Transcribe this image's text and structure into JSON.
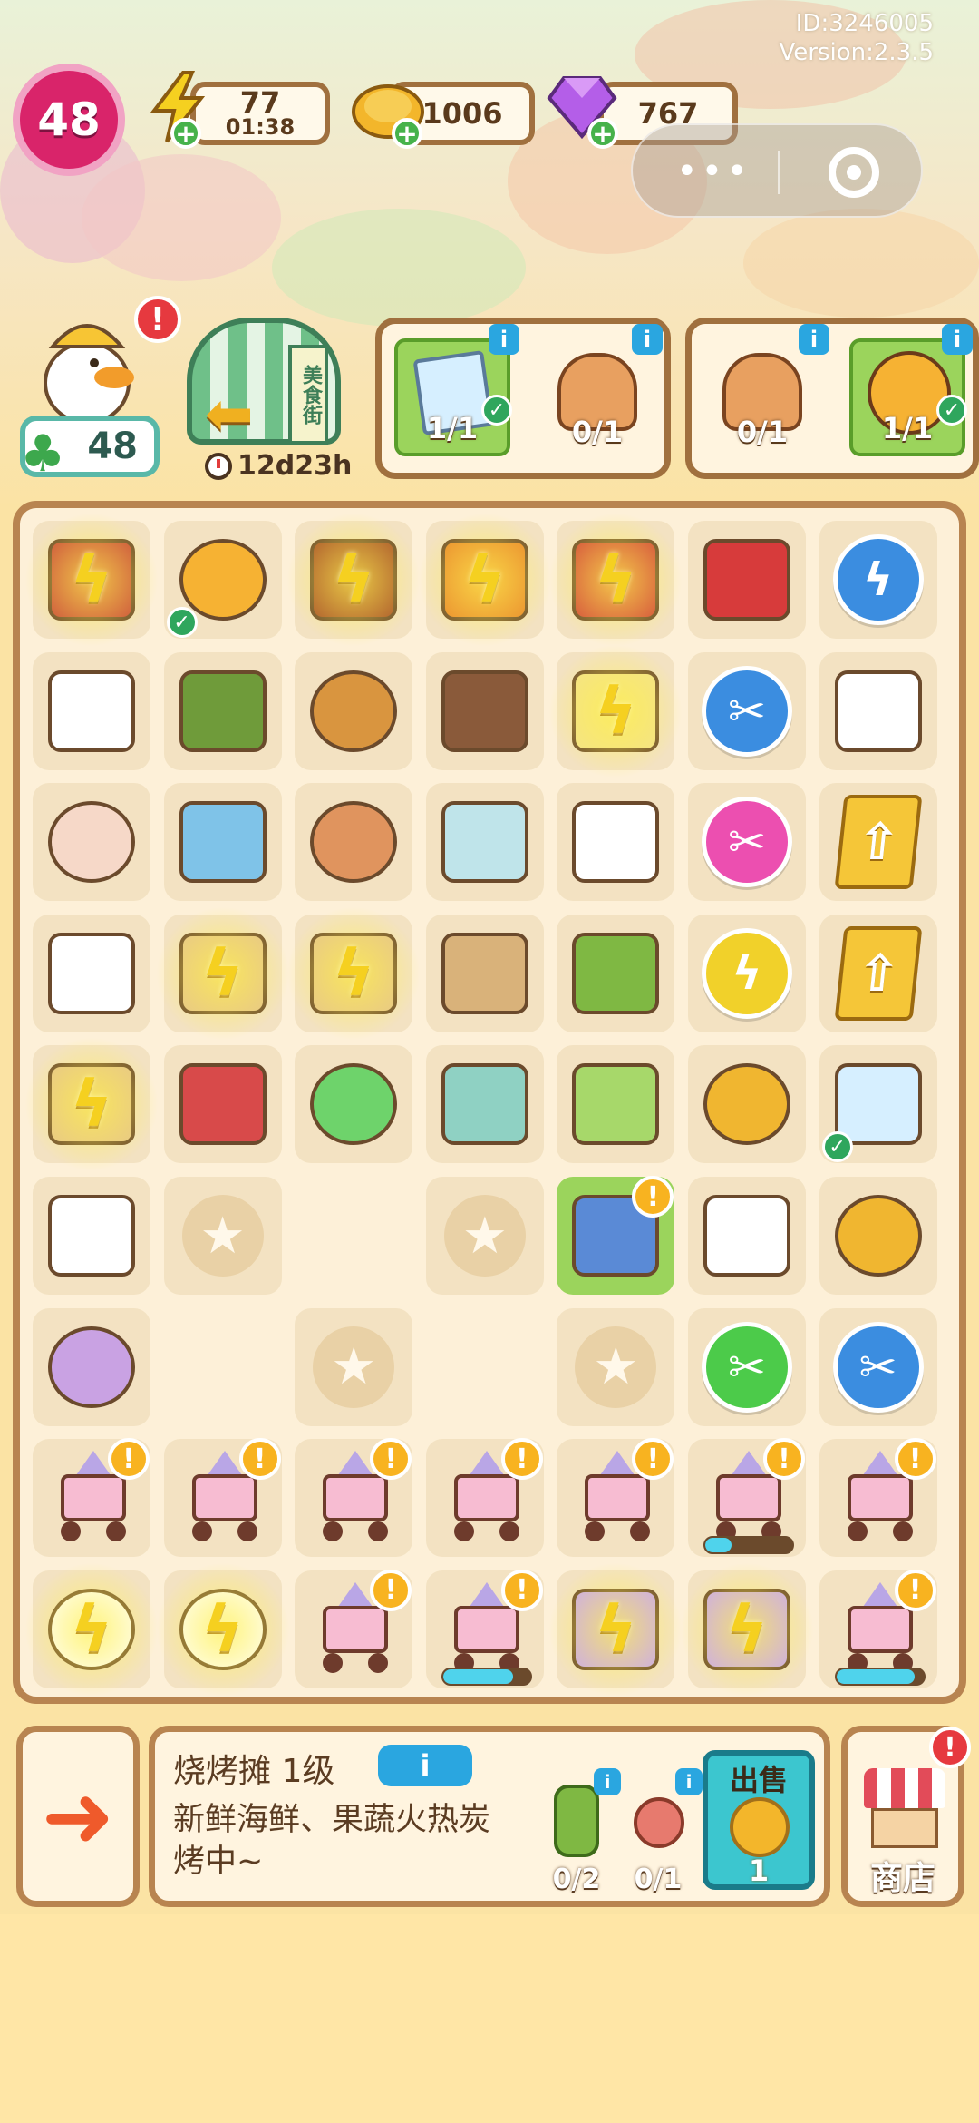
{
  "meta": {
    "id_line": "ID:3246005",
    "version_line": "Version:2.3.5"
  },
  "hud": {
    "level": "48",
    "energy": {
      "value": "77",
      "timer": "01:38",
      "icon": "lightning-icon"
    },
    "coins": {
      "value": "1006",
      "icon": "coin-icon"
    },
    "gems": {
      "value": "767",
      "icon": "gem-icon"
    },
    "plus": "+"
  },
  "capsule": {
    "more": "•••",
    "close_icon": "target-icon"
  },
  "mascot": {
    "alert": "!",
    "clover_count": "48"
  },
  "event": {
    "sign": "美食街",
    "timer": "12d23h"
  },
  "orders": [
    {
      "slots": [
        {
          "name": "photo-card",
          "count": "1/1",
          "done": true
        },
        {
          "name": "burrito",
          "count": "0/1",
          "done": false
        }
      ]
    },
    {
      "slots": [
        {
          "name": "burrito",
          "count": "0/1",
          "done": false
        },
        {
          "name": "tiger-plush",
          "count": "1/1",
          "done": true
        }
      ]
    }
  ],
  "board": {
    "cells": [
      [
        "spice-bag-lightning",
        "tiger-plush",
        "bbq-grill-lightning",
        "umbrella-cart-lightning",
        "truck-lightning",
        "red-fridge",
        "energy-orb-blue"
      ],
      [
        "takeout-box",
        "green-apron",
        "pancakes",
        "grilled-skewers",
        "food-truck-lightning",
        "scissors-blue",
        "chef-hat"
      ],
      [
        "ice-cream",
        "gift-box-blue",
        "eggs",
        "cups-stack",
        "takeout-box",
        "scissors-pink",
        "upgrade-card"
      ],
      [
        "chef-hat",
        "parcel-cart-lightning",
        "parcel-cart-lightning",
        "cardboard-boxes",
        "gas-tank",
        "energy-coin",
        "upgrade-card"
      ],
      [
        "parcel-cart-lightning",
        "gift-box-red",
        "green-gem",
        "energy-chest",
        "gift-box-green",
        "coin-pile",
        "photo-card"
      ],
      [
        "megaphone",
        "locked",
        "blank",
        "locked",
        "bbq-stall",
        "glove",
        "coin-heap"
      ],
      [
        "flower-wreath",
        "blank",
        "locked",
        "blank",
        "locked",
        "scissors-green",
        "scissors-blue"
      ],
      [
        "pink-cart",
        "pink-cart",
        "pink-cart",
        "pink-cart",
        "pink-cart",
        "pink-cart-progress",
        "pink-cart"
      ],
      [
        "duck-mascot-lightning",
        "duck-mascot-lightning",
        "pink-cart",
        "pink-cart-progress",
        "purple-cart-lightning",
        "purple-cart-lightning",
        "pink-cart-progress"
      ]
    ],
    "progress": {
      "row7": 0.3,
      "row8a": 0.8,
      "row8b": 0.9
    }
  },
  "panel": {
    "title": "烧烤摊 1级",
    "info": "i",
    "desc": "新鲜海鲜、果蔬火热炭烤中~",
    "requirements": [
      {
        "name": "gas-tank",
        "count": "0/2"
      },
      {
        "name": "meat-dish",
        "count": "0/1"
      }
    ],
    "sell": {
      "label": "出售",
      "value": "1"
    },
    "shop": {
      "label": "商店",
      "alert": "!"
    }
  },
  "colors": {
    "accent": "#b88450",
    "level": "#d9246a",
    "gem": "#b45ee8",
    "progress": "#4fd3ec"
  }
}
